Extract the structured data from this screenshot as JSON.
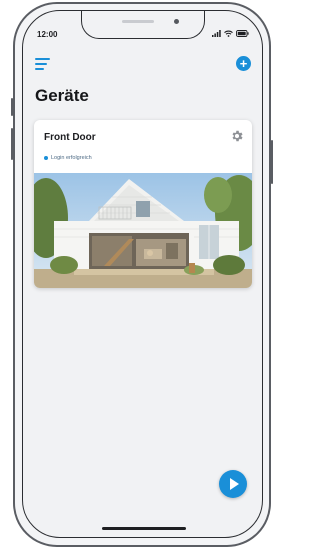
{
  "status_bar": {
    "time": "12:00"
  },
  "header": {
    "title": "Geräte"
  },
  "device_card": {
    "name": "Front Door",
    "status": "Login erfolgreich"
  },
  "colors": {
    "accent": "#1a8fd8",
    "background": "#f1f2f4",
    "card": "#ffffff"
  },
  "icons": [
    "menu-icon",
    "add-icon",
    "settings-gear-icon",
    "play-icon",
    "wifi-icon",
    "signal-icon",
    "battery-icon"
  ]
}
